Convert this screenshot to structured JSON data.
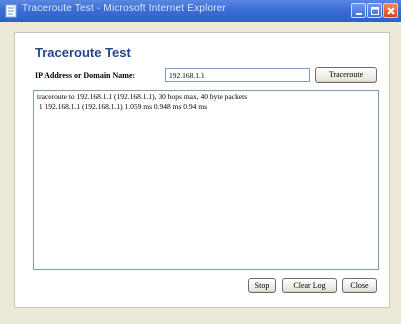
{
  "window": {
    "title": "Traceroute Test - Microsoft Internet Explorer"
  },
  "page": {
    "heading": "Traceroute Test"
  },
  "form": {
    "label": "IP Address or Domain Name:",
    "value": "192.168.1.1",
    "traceroute_label": "Traceroute"
  },
  "log": {
    "text": "traceroute to 192.168.1.1 (192.168.1.1), 30 hops max, 40 byte packets\n 1 192.168.1.1 (192.168.1.1) 1.059 ms 0.948 ms 0.94 ms"
  },
  "actions": {
    "stop_label": "Stop",
    "clear_label": "Clear Log",
    "close_label": "Close"
  },
  "colors": {
    "titlebar": "#3c6fd6",
    "heading": "#27458f",
    "frame": "#ece9d8"
  },
  "icons": {
    "app": "ie-page-icon",
    "minimize": "minimize-icon",
    "maximize": "maximize-icon",
    "close": "close-icon"
  }
}
